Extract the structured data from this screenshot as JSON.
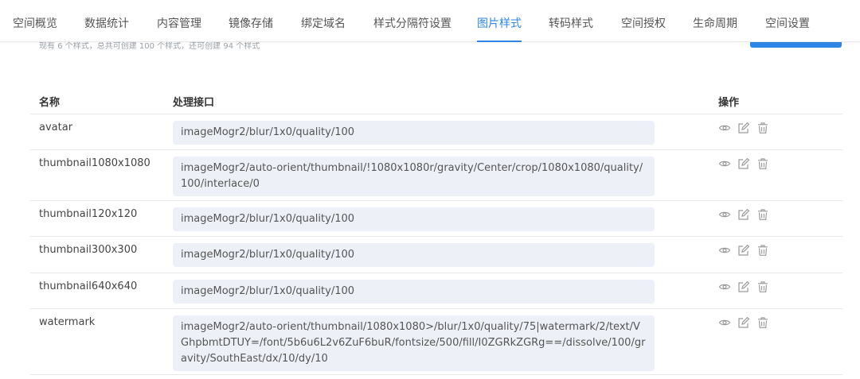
{
  "tabs": [
    {
      "label": "空间概览",
      "active": false
    },
    {
      "label": "数据统计",
      "active": false
    },
    {
      "label": "内容管理",
      "active": false
    },
    {
      "label": "镜像存储",
      "active": false
    },
    {
      "label": "绑定域名",
      "active": false
    },
    {
      "label": "样式分隔符设置",
      "active": false
    },
    {
      "label": "图片样式",
      "active": true
    },
    {
      "label": "转码样式",
      "active": false
    },
    {
      "label": "空间授权",
      "active": false
    },
    {
      "label": "生命周期",
      "active": false
    },
    {
      "label": "空间设置",
      "active": false
    }
  ],
  "summary": "现有 6 个样式，总共可创建 100 个样式，还可创建 94 个样式",
  "table": {
    "headers": {
      "name": "名称",
      "api": "处理接口",
      "ops": "操作"
    },
    "rows": [
      {
        "name": "avatar",
        "api": "imageMogr2/blur/1x0/quality/100"
      },
      {
        "name": "thumbnail1080x1080",
        "api": "imageMogr2/auto-orient/thumbnail/!1080x1080r/gravity/Center/crop/1080x1080/quality/100/interlace/0"
      },
      {
        "name": "thumbnail120x120",
        "api": "imageMogr2/blur/1x0/quality/100"
      },
      {
        "name": "thumbnail300x300",
        "api": "imageMogr2/blur/1x0/quality/100"
      },
      {
        "name": "thumbnail640x640",
        "api": "imageMogr2/blur/1x0/quality/100"
      },
      {
        "name": "watermark",
        "api": "imageMogr2/auto-orient/thumbnail/1080x1080>/blur/1x0/quality/75|watermark/2/text/VGhpbmtDTUY=/font/5b6u6L2v6ZuF6buR/fontsize/500/fill/I0ZGRkZGRg==/dissolve/100/gravity/SouthEast/dx/10/dy/10"
      }
    ]
  },
  "icons": {
    "view": "eye-icon",
    "edit": "edit-icon",
    "delete": "trash-icon"
  },
  "colors": {
    "accent": "#2d86e6",
    "code_bg": "#eef0f7"
  }
}
